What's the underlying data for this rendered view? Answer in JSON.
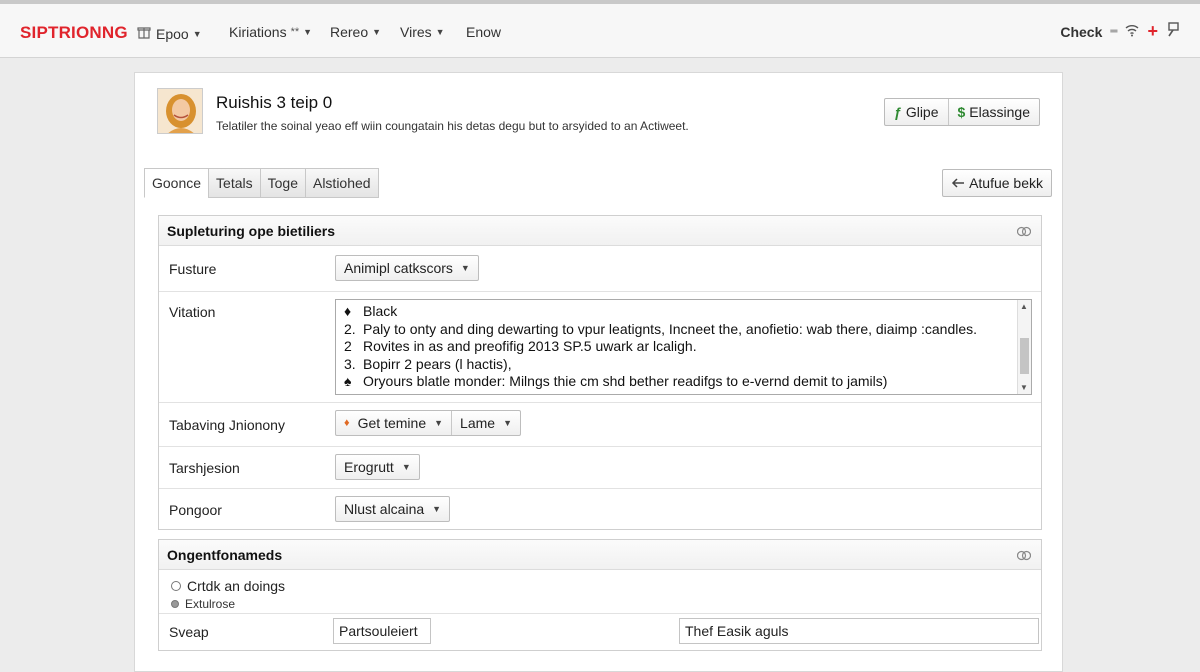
{
  "nav": {
    "brand": "SIPTRIONNG",
    "items": [
      {
        "label": "Epoo",
        "has_caret": true,
        "has_icon": true
      },
      {
        "label": "Kiriations",
        "extra": "**",
        "has_caret": true
      },
      {
        "label": "Rereo",
        "has_caret": true
      },
      {
        "label": "Vires",
        "has_caret": true
      },
      {
        "label": "Enow",
        "has_caret": false
      }
    ],
    "right": {
      "check_label": "Check"
    }
  },
  "profile": {
    "name": "Ruishis 3 teip 0",
    "description": "Telatiler the soinal yeao eff wiin coungatain his detas degu but to arsyided to an Actiweet.",
    "buttons": {
      "globe_label": "Glipe",
      "settings_label": "Elassinge"
    }
  },
  "tabs": [
    {
      "label": "Goonce",
      "active": true
    },
    {
      "label": "Tetals",
      "active": false
    },
    {
      "label": "Toge",
      "active": false
    },
    {
      "label": "Alstiohed",
      "active": false
    }
  ],
  "back_button": {
    "label": "Atufue bekk"
  },
  "section1": {
    "title": "Supleturing ope bietiliers",
    "rows": {
      "feature": {
        "label": "Fusture",
        "value": "Animipl catkscors"
      },
      "vitation": {
        "label": "Vitation",
        "lines": [
          {
            "marker": "♦",
            "text": "Black"
          },
          {
            "marker": "2.",
            "text": "Paly to onty and ding dewarting to vpur leatignts, Incneet the, anofietio: wab there, diaimp :candles."
          },
          {
            "marker": "2",
            "text": "Rovites in as and preofifig 2013 SP.5 uwark ar lcaligh."
          },
          {
            "marker": "3.",
            "text": "Bopirr 2 pears (l hactis),"
          },
          {
            "marker": "♠",
            "text": "Oryours blatle monder: Milngs thie cm shd bether readifgs to e-vernd demit to jamils)"
          }
        ]
      },
      "tabaving": {
        "label": "Tabaving Jnionony",
        "value_a": "Get temine",
        "value_b": "Lame"
      },
      "tarshjesion": {
        "label": "Tarshjesion",
        "value": "Erogrutt"
      },
      "pongoor": {
        "label": "Pongoor",
        "value": "Nlust alcaina"
      }
    }
  },
  "section2": {
    "title": "Ongentfonameds",
    "radio_main": "Crtdk an doings",
    "radio_sub": "Extulrose",
    "sveap": {
      "label": "Sveap",
      "field_a": "Partsouleiert",
      "field_b": "Thef Easik aguls"
    }
  },
  "colors": {
    "brand": "#e0242c",
    "green": "#2f8a32",
    "accent_plus": "#e0242c"
  },
  "icons": [
    "gift-icon",
    "wifi-icon",
    "plus-icon",
    "pin-icon",
    "leaf-icon",
    "dollar-icon",
    "back-arrow-icon",
    "toggle-icon",
    "flame-icon"
  ]
}
